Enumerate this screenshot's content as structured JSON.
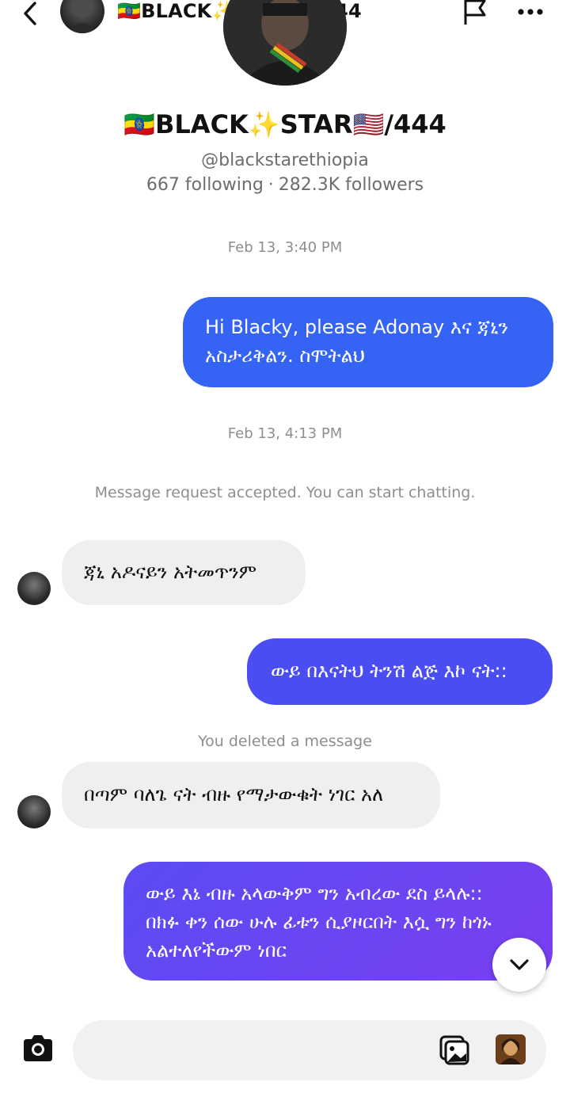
{
  "header": {
    "title": "🇪🇹BLACK✨STAR🇺🇸/444"
  },
  "profile": {
    "name": "🇪🇹BLACK✨STAR🇺🇸/444",
    "handle": "@blackstarethiopia",
    "following": "667 following",
    "separator": "·",
    "followers": "282.3K followers"
  },
  "chat": {
    "timestamp_1": "Feb 13, 3:40 PM",
    "msg_out_1_line1": "Hi Blacky, please Adonay እና ጃኒን",
    "msg_out_1_line2": "አስታሪቅልን. ስሞትልህ",
    "timestamp_2": "Feb 13, 4:13 PM",
    "system_accepted": "Message request accepted. You can start chatting.",
    "msg_in_1": "ጃኒ አዶናይን አትመጥንም",
    "msg_out_2": "ውይ በእናትህ ትንሽ ልጅ እኮ ናት::",
    "system_deleted": "You deleted a message",
    "msg_in_2": "በጣም ባለጌ ናት ብዙ የማታውቁት ነገር አለ",
    "msg_out_3_line1": "ውይ እኔ ብዙ አላውቅም ግን አብረው ደስ ይላሉ::",
    "msg_out_3_line2": "በክፉ ቀን ሰው ሁሉ ፊቱን ሲያዞርበት እሷ ግን ከጎኑ",
    "msg_out_3_line3": "አልተለየችውም ነበር"
  },
  "colors": {
    "bubble_blue": "#3563f4",
    "bubble_indigo": "#4a4ef2",
    "bubble_purple": "#7a3ff0",
    "incoming_bg": "#efefef",
    "meta_text": "#8e8e8e"
  },
  "icons": {
    "back": "chevron-left-icon",
    "flag": "flag-icon",
    "more": "more-horizontal-icon",
    "scroll": "chevron-down-icon",
    "camera": "camera-icon",
    "gallery": "gallery-icon",
    "sticker": "sticker-icon"
  }
}
